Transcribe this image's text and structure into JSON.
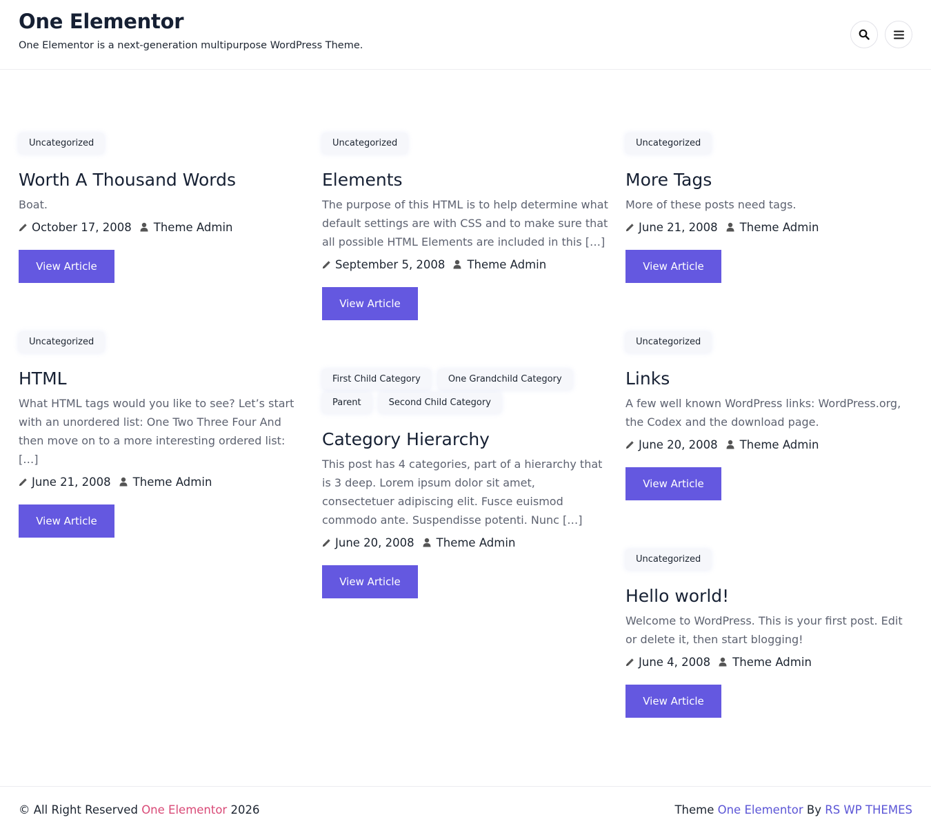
{
  "header": {
    "site_title": "One Elementor",
    "tagline": "One Elementor is a next-generation multipurpose WordPress Theme."
  },
  "icons": {
    "search": "search-icon",
    "menu": "hamburger-menu-icon",
    "date": "pencil-icon",
    "author": "user-icon"
  },
  "colors": {
    "button_bg": "#6458e0",
    "footer_link_pink": "#d94a77",
    "footer_link_purple": "#5b55d6"
  },
  "posts": [
    {
      "categories": [
        "Uncategorized"
      ],
      "title": "Worth A Thousand Words",
      "excerpt": "Boat.",
      "date": "October 17, 2008",
      "author": "Theme Admin",
      "button": "View Article"
    },
    {
      "categories": [
        "Uncategorized"
      ],
      "title": "Elements",
      "excerpt": "The purpose of this HTML is to help determine what default settings are with CSS and to make sure that all possible HTML Elements are included in this […]",
      "date": "September 5, 2008",
      "author": "Theme Admin",
      "button": "View Article"
    },
    {
      "categories": [
        "Uncategorized"
      ],
      "title": "More Tags",
      "excerpt": "More of these posts need tags.",
      "date": "June 21, 2008",
      "author": "Theme Admin",
      "button": "View Article"
    },
    {
      "categories": [
        "Uncategorized"
      ],
      "title": "HTML",
      "excerpt": "What HTML tags would you like to see? Let’s start with an unordered list: One Two Three Four And then move on to a more interesting ordered list: […]",
      "date": "June 21, 2008",
      "author": "Theme Admin",
      "button": "View Article"
    },
    {
      "categories": [
        "First Child Category",
        "One Grandchild Category",
        "Parent",
        "Second Child Category"
      ],
      "title": "Category Hierarchy",
      "excerpt": "This post has 4 categories, part of a hierarchy that is 3 deep. Lorem ipsum dolor sit amet, consectetuer adipiscing elit. Fusce euismod commodo ante. Suspendisse potenti. Nunc […]",
      "date": "June 20, 2008",
      "author": "Theme Admin",
      "button": "View Article"
    },
    {
      "categories": [
        "Uncategorized"
      ],
      "title": "Links",
      "excerpt": "A few well known WordPress links: WordPress.org, the Codex and the download page.",
      "date": "June 20, 2008",
      "author": "Theme Admin",
      "button": "View Article"
    },
    {
      "categories": [
        "Uncategorized"
      ],
      "title": "Hello world!",
      "excerpt": "Welcome to WordPress. This is your first post. Edit or delete it, then start blogging!",
      "date": "June 4, 2008",
      "author": "Theme Admin",
      "button": "View Article"
    }
  ],
  "footer": {
    "copyright_prefix": "© All Right Reserved",
    "copyright_link": "One Elementor",
    "copyright_year": "2026",
    "theme_prefix": "Theme",
    "theme_link": "One Elementor",
    "by_text": "By",
    "author_link": "RS WP THEMES"
  }
}
